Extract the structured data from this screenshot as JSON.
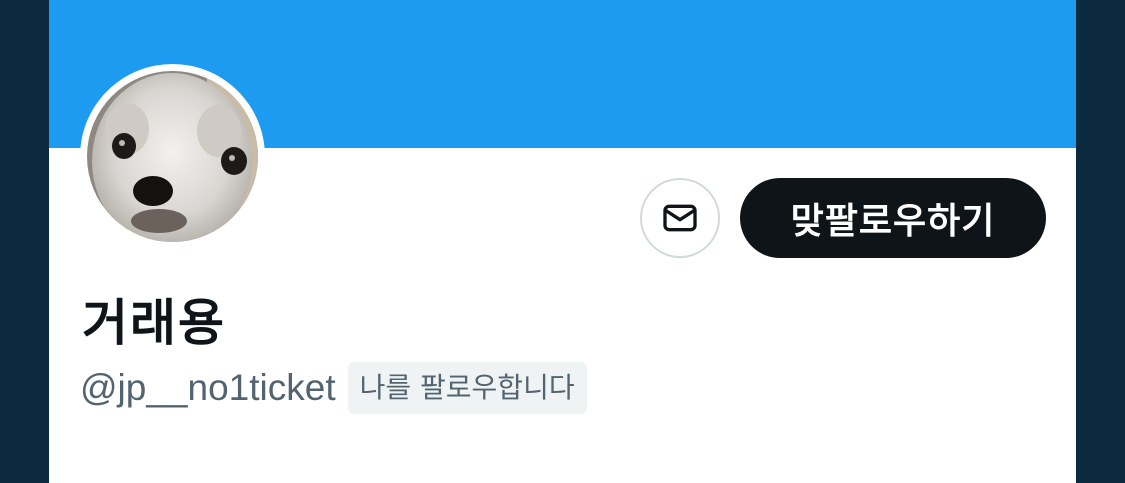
{
  "colors": {
    "banner": "#1d9bf0",
    "page_background": "#0b2a3f",
    "follow_button": "#0f1419",
    "secondary_text": "#536471"
  },
  "profile": {
    "display_name": "거래용",
    "handle": "@jp__no1ticket",
    "follows_you_badge": "나를 팔로우합니다"
  },
  "actions": {
    "message_icon": "envelope-icon",
    "follow_back_label": "맞팔로우하기"
  }
}
